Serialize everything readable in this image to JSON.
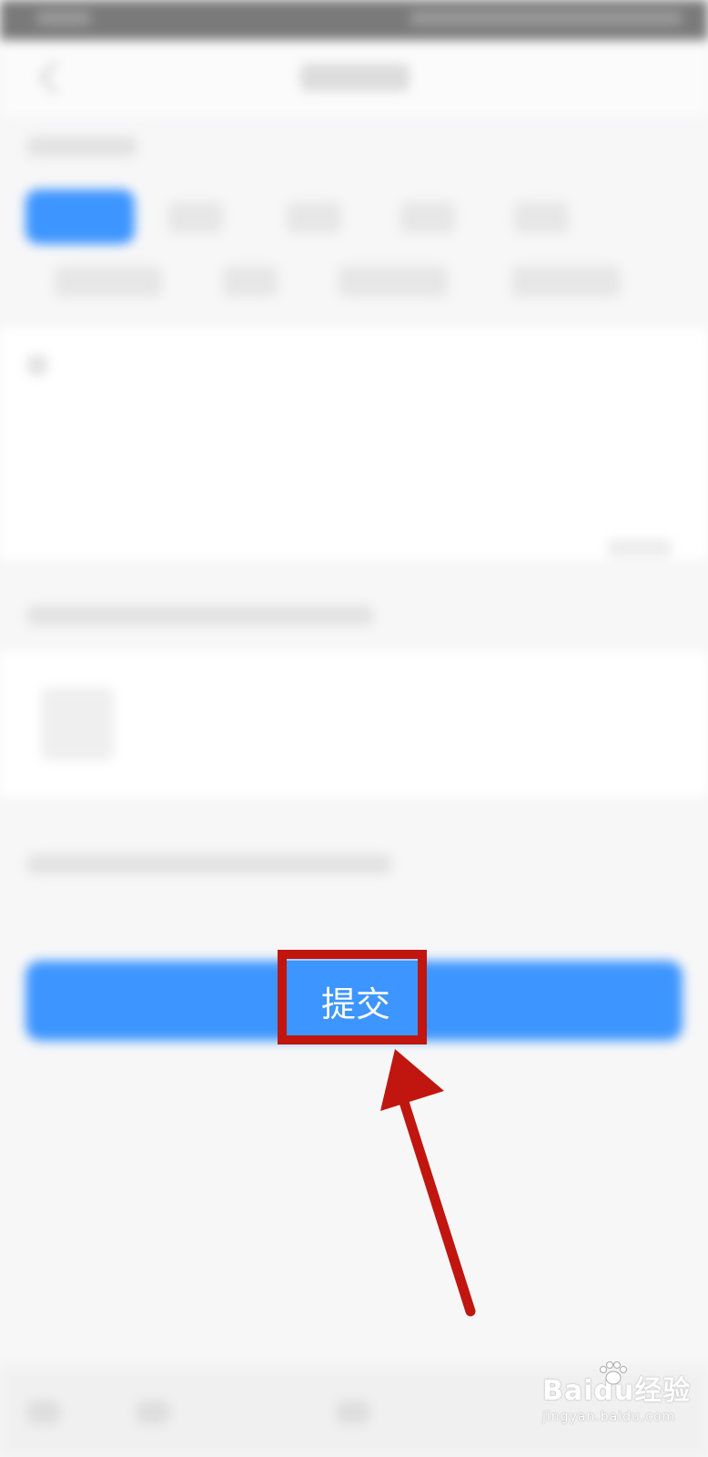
{
  "colors": {
    "primary_blue": "#3d95ff",
    "highlight_red": "#c0160f",
    "background": "#f7f7f8"
  },
  "submit": {
    "label": "提交"
  },
  "icons": {
    "back": "back-arrow-icon",
    "pointer": "red-arrow-annotation",
    "watermark_logo": "baidu-paw-icon"
  },
  "watermark": {
    "brand": "Baidu经验",
    "url": "jingyan.baidu.com"
  }
}
